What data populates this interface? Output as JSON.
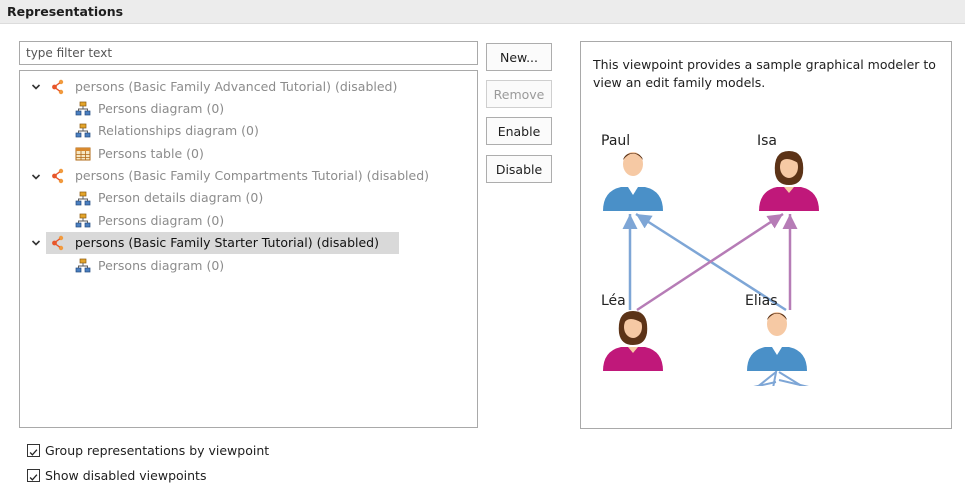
{
  "header": {
    "title": "Representations"
  },
  "filter": {
    "value": "type filter text"
  },
  "tree": {
    "groups": [
      {
        "label": "persons (Basic Family Advanced Tutorial) (disabled)",
        "children": [
          "Persons diagram (0)",
          "Relationships diagram (0)",
          "Persons table (0)"
        ]
      },
      {
        "label": "persons (Basic Family Compartments Tutorial) (disabled)",
        "children": [
          "Person details diagram (0)",
          "Persons diagram (0)"
        ]
      },
      {
        "label": "persons (Basic Family Starter Tutorial) (disabled)",
        "children": [
          "Persons diagram (0)"
        ]
      }
    ]
  },
  "buttons": {
    "new": "New...",
    "remove": "Remove",
    "enable": "Enable",
    "disable": "Disable"
  },
  "description": {
    "text": "This viewpoint provides a sample graphical modeler to view an edit family models.",
    "people": [
      "Paul",
      "Isa",
      "Léa",
      "Elias"
    ]
  },
  "options": {
    "group_by_viewpoint": {
      "label": "Group representations by viewpoint",
      "checked": true
    },
    "show_disabled": {
      "label": "Show disabled viewpoints",
      "checked": true
    }
  },
  "colors": {
    "male": "#4a90c8",
    "female": "#c0187a",
    "blue_arrow": "#7ea6d6",
    "purple_arrow": "#b67cb6",
    "viewpoint_icon": "#e8562a"
  }
}
